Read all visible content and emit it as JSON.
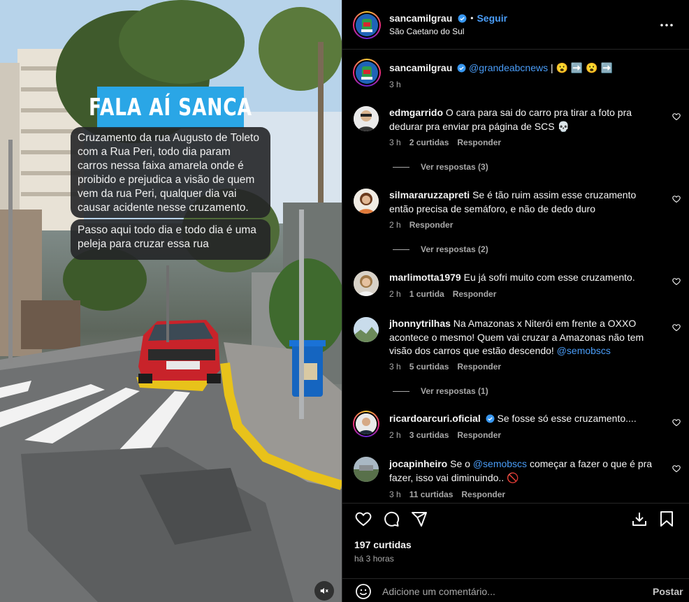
{
  "media": {
    "banner": "FALA AÍ SANCA",
    "bubble1": "Cruzamento da rua Augusto de Toleto com a Rua Peri, todo dia param carros nessa faixa amarela onde é proibido e prejudica a visão de quem vem da rua Peri, qualquer dia vai causar acidente nesse cruzamento.",
    "bubble2": "Passo aqui todo dia e todo dia é uma peleja para cruzar essa rua",
    "mute_icon": "speaker-muted-icon"
  },
  "header": {
    "username": "sancamilgrau",
    "separator": "•",
    "follow_label": "Seguir",
    "location": "São Caetano do Sul",
    "more_icon": "more-options-icon"
  },
  "caption": {
    "username": "sancamilgrau",
    "mention": "@grandeabcnews",
    "text": " | 😮 ➡️ 😮 ➡️",
    "time": "3 h"
  },
  "comments": [
    {
      "username": "edmgarrido",
      "text": "O cara para sai do carro pra tirar a foto pra dedurar pra enviar pra página de SCS 💀",
      "time": "3 h",
      "likes": "2 curtidas",
      "reply": "Responder",
      "view_replies": "Ver respostas (3)"
    },
    {
      "username": "silmararuzzapreti",
      "text": "Se é tão ruim assim esse cruzamento então precisa de semáforo, e não de dedo duro",
      "time": "2 h",
      "likes": "",
      "reply": "Responder",
      "view_replies": "Ver respostas (2)"
    },
    {
      "username": "marlimotta1979",
      "text": "Eu já sofri muito com esse cruzamento.",
      "time": "2 h",
      "likes": "1 curtida",
      "reply": "Responder",
      "view_replies": ""
    },
    {
      "username": "jhonnytrilhas",
      "text": "Na Amazonas x Niterói em frente a OXXO acontece o mesmo! Quem vai cruzar a Amazonas não tem visão dos carros que estão descendo!",
      "mention": "@semobscs",
      "time": "3 h",
      "likes": "5 curtidas",
      "reply": "Responder",
      "view_replies": "Ver respostas (1)"
    },
    {
      "username": "ricardoarcuri.oficial",
      "text": "Se fosse só esse cruzamento....",
      "time": "2 h",
      "likes": "3 curtidas",
      "reply": "Responder",
      "view_replies": ""
    },
    {
      "username": "jocapinheiro",
      "text_before": "Se o",
      "mention": "@semobscs",
      "text": "começar a fazer o que é pra fazer, isso vai diminuindo.. 🚫",
      "time": "3 h",
      "likes": "11 curtidas",
      "reply": "Responder",
      "view_replies": ""
    }
  ],
  "actions": {
    "like_icon": "heart-icon",
    "comment_icon": "comment-icon",
    "share_icon": "share-icon",
    "save_download_icon": "download-icon",
    "bookmark_icon": "bookmark-icon",
    "likes_count": "197 curtidas",
    "posted": "há 3 horas"
  },
  "composer": {
    "emoji_icon": "emoji-icon",
    "placeholder": "Adicione um comentário...",
    "post_label": "Postar"
  },
  "colors": {
    "accent": "#4a9df8",
    "banner": "#2aa6e6",
    "curb_yellow": "#e8c21a",
    "car_red": "#c8232a"
  }
}
